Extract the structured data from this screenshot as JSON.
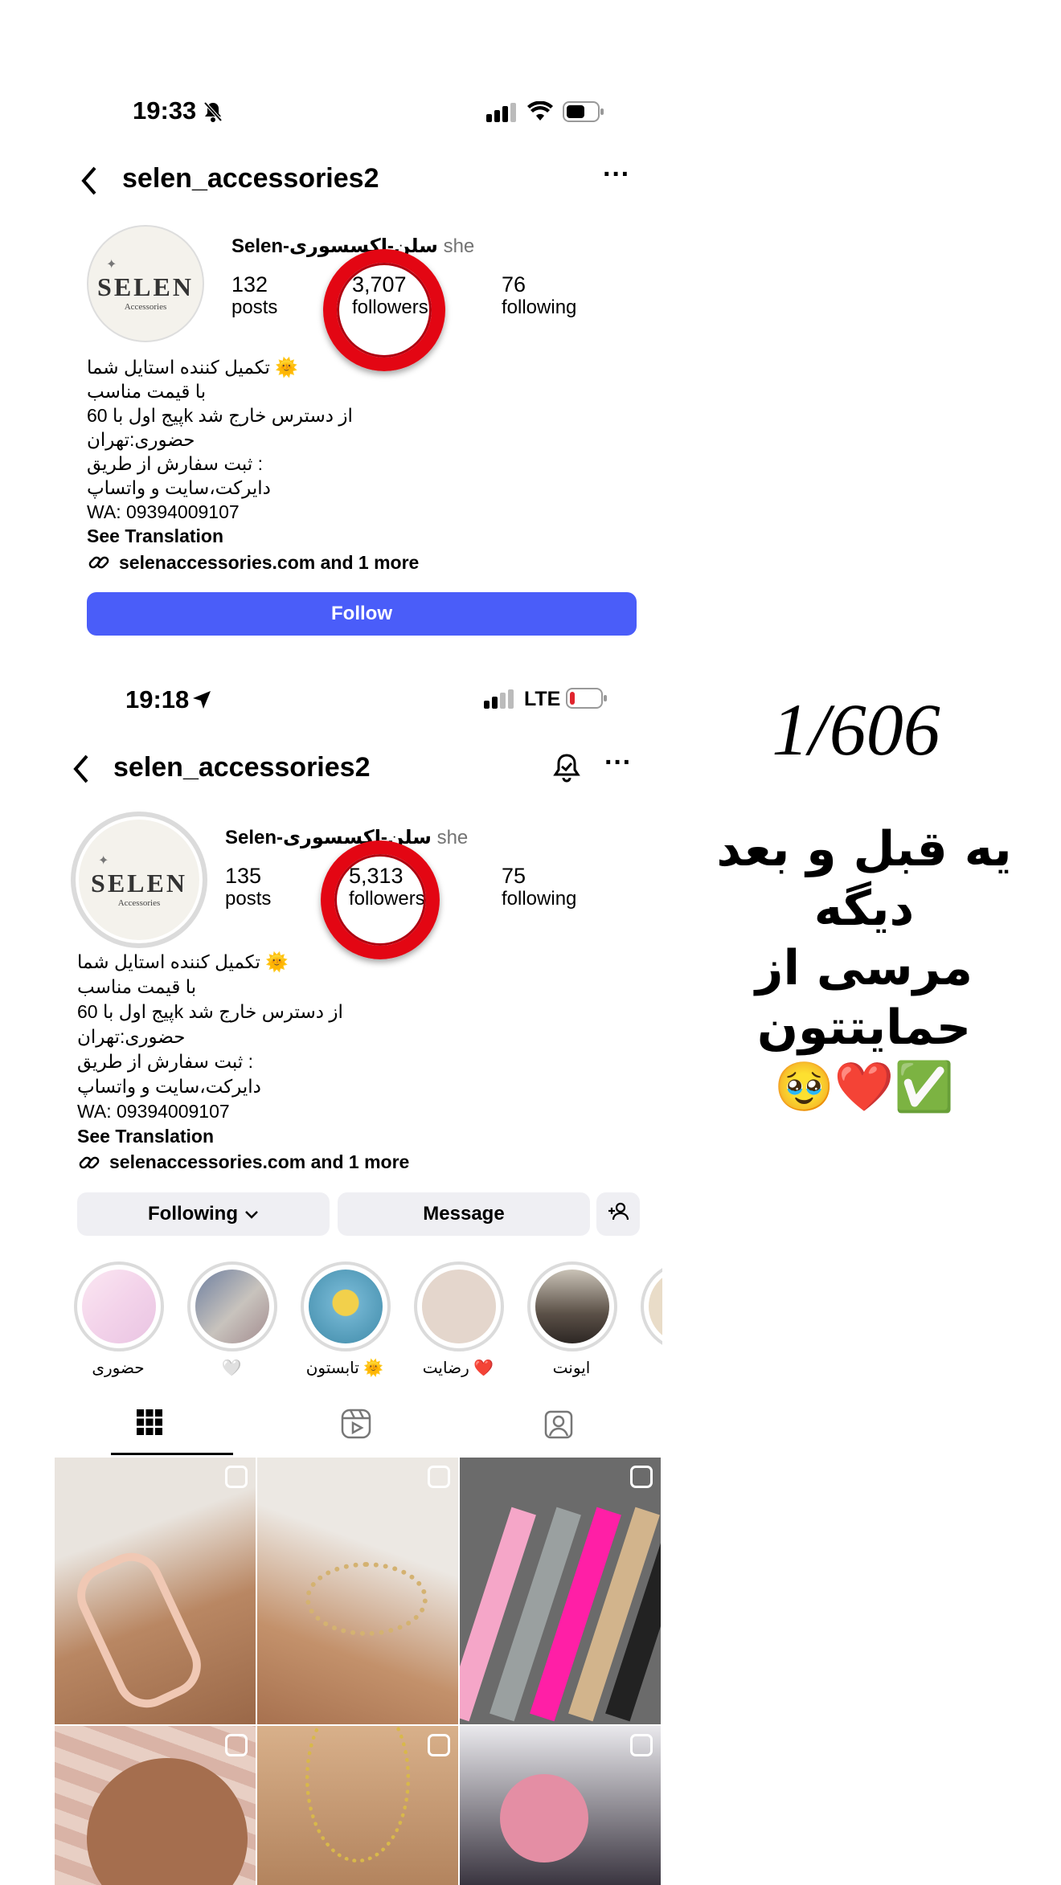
{
  "top": {
    "status": {
      "time": "19:33"
    },
    "header": {
      "username": "selen_accessories2",
      "more": "···"
    },
    "profile": {
      "logo": "SELEN",
      "logo_sub": "Accessories",
      "full_name": "Selen-سلن-اکسسوری",
      "pronoun": "she",
      "posts": "132",
      "posts_label": "posts",
      "followers": "3,707",
      "followers_label": "followers",
      "following": "76",
      "following_label": "following"
    },
    "bio": [
      "تکمیل کننده استایل شما 🌞",
      "با قیمت مناسب",
      "پیج اول با 60k از دسترس خارج شد",
      "حضوری:تهران",
      "ثبت سفارش از طریق :",
      "دایرکت،سایت و واتساپ",
      "WA: 09394009107"
    ],
    "see_translation": "See Translation",
    "link": "selenaccessories.com and 1 more",
    "follow_button": "Follow"
  },
  "bottom": {
    "status": {
      "time": "19:18",
      "network": "LTE"
    },
    "header": {
      "username": "selen_accessories2",
      "more": "···"
    },
    "profile": {
      "logo": "SELEN",
      "logo_sub": "Accessories",
      "full_name": "Selen-سلن-اکسسوری",
      "pronoun": "she",
      "posts": "135",
      "posts_label": "posts",
      "followers": "5,313",
      "followers_label": "followers",
      "following": "75",
      "following_label": "following"
    },
    "bio": [
      "تکمیل کننده استایل شما 🌞",
      "با قیمت مناسب",
      "پیج اول با 60k از دسترس خارج شد",
      "حضوری:تهران",
      "ثبت سفارش از طریق :",
      "دایرکت،سایت و واتساپ",
      "WA: 09394009107"
    ],
    "see_translation": "See Translation",
    "link": "selenaccessories.com and 1 more",
    "following_button": "Following",
    "message_button": "Message",
    "stories": [
      "حضوری",
      "🤍",
      "تابستون 🌞",
      "رضایت ❤️",
      "ایونت"
    ]
  },
  "overlay": {
    "ratio": "1/606",
    "lines": [
      "یه قبل و بعد",
      "دیگه",
      "مرسی از",
      "حمایتتون"
    ],
    "emojis": "🥹❤️✅"
  }
}
